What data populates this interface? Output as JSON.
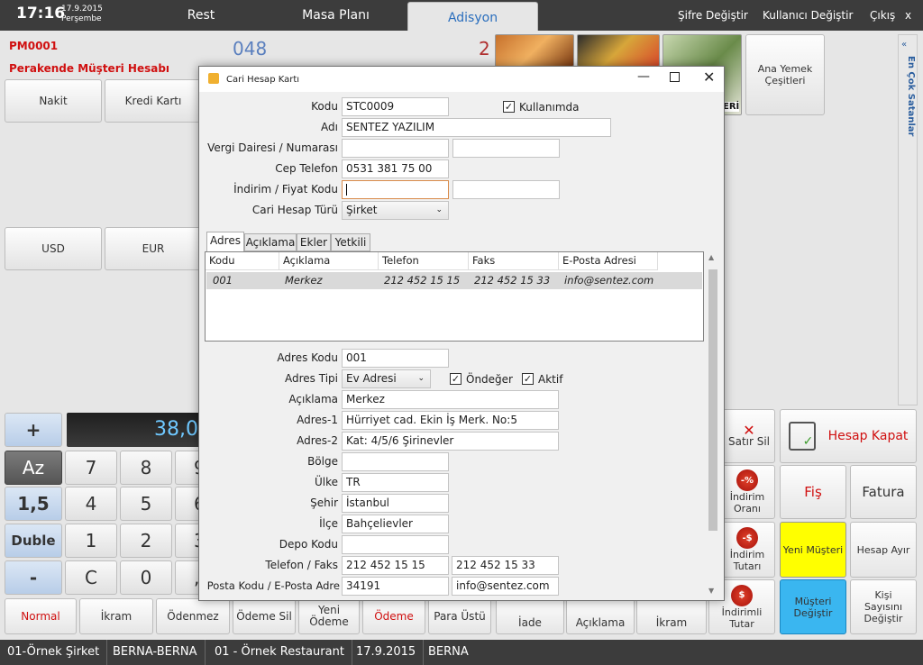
{
  "topbar": {
    "time": "17:16",
    "date": "17.9.2015",
    "weekday": "Perşembe",
    "tabs": [
      "Rest",
      "Masa Planı",
      "Adisyon"
    ],
    "links": [
      "Şifre Değiştir",
      "Kullanıcı Değiştir",
      "Çıkış",
      "x"
    ]
  },
  "account": {
    "code": "PM0001",
    "name": "Perakende Müşteri Hesabı",
    "table_no": "048",
    "guest_count": "2"
  },
  "payment_buttons": [
    "Nakit",
    "Kredi Kartı",
    "USD",
    "EUR"
  ],
  "category": {
    "label": "Ana Yemek Çeşitleri",
    "partial_tile_text": "ERİ"
  },
  "sidebar_right": {
    "label": "En Çok Satanlar"
  },
  "keypad": {
    "display": "38,0",
    "side": [
      "+",
      "Az",
      "1,5",
      "Duble",
      "-"
    ],
    "digits": [
      [
        "7",
        "8",
        "9"
      ],
      [
        "4",
        "5",
        "6"
      ],
      [
        "1",
        "2",
        "3"
      ],
      [
        "C",
        "0",
        ","
      ]
    ]
  },
  "bottom_buttons": [
    "Normal",
    "İkram",
    "Ödenmez",
    "Ödeme Sil",
    "Yeni Ödeme",
    "Ödeme",
    "Para Üstü",
    "İade",
    "Açıklama",
    "İkram",
    "İndirimli Tutar"
  ],
  "right_buttons": {
    "satir_sil": "Satır Sil",
    "hesap_kapat": "Hesap Kapat",
    "indirim_orani": "İndirim Oranı",
    "fis": "Fiş",
    "fatura": "Fatura",
    "indirim_tutari": "İndirim Tutarı",
    "yeni_musteri": "Yeni Müşteri",
    "hesap_ayir": "Hesap Ayır",
    "musteri_degistir": "Müşteri Değiştir",
    "kisi_sayisi": "Kişi Sayısını Değiştir",
    "pct_badge": "-%",
    "money_badge": "-$",
    "money_badge2": "$"
  },
  "statusbar": [
    "01-Örnek Şirket",
    "BERNA-BERNA",
    "01 - Örnek Restaurant",
    "17.9.2015",
    "BERNA"
  ],
  "dialog": {
    "title": "Cari Hesap Kartı",
    "labels": {
      "kodu": "Kodu",
      "adi": "Adı",
      "vergi": "Vergi Dairesi / Numarası",
      "cep": "Cep Telefon",
      "indirim": "İndirim / Fiyat Kodu",
      "tur": "Cari Hesap Türü",
      "kullanimda": "Kullanımda"
    },
    "values": {
      "kodu": "STC0009",
      "adi": "SENTEZ YAZILIM",
      "vergi_dairesi": "",
      "vergi_no": "",
      "cep": "0531 381 75 00",
      "indirim": "",
      "fiyat_kodu": "",
      "tur": "Şirket"
    },
    "tabs": [
      "Adres",
      "Açıklama",
      "Ekler",
      "Yetkili"
    ],
    "grid": {
      "headers": [
        "Kodu",
        "Açıklama",
        "Telefon",
        "Faks",
        "E-Posta Adresi"
      ],
      "rows": [
        [
          "001",
          "Merkez",
          "212 452 15 15",
          "212 452 15 33",
          "info@sentez.com"
        ]
      ]
    },
    "address": {
      "labels": {
        "adres_kodu": "Adres Kodu",
        "adres_tipi": "Adres Tipi",
        "ondeger": "Öndeğer",
        "aktif": "Aktif",
        "aciklama": "Açıklama",
        "adres1": "Adres-1",
        "adres2": "Adres-2",
        "bolge": "Bölge",
        "ulke": "Ülke",
        "sehir": "Şehir",
        "ilce": "İlçe",
        "depo": "Depo Kodu",
        "telefon": "Telefon / Faks",
        "posta": "Posta Kodu / E-Posta Adre"
      },
      "values": {
        "adres_kodu": "001",
        "adres_tipi": "Ev Adresi",
        "aciklama": "Merkez",
        "adres1": "Hürriyet cad. Ekin İş Merk. No:5",
        "adres2": "Kat: 4/5/6 Şirinevler",
        "bolge": "",
        "ulke": "TR",
        "sehir": "İstanbul",
        "ilce": "Bahçelievler",
        "depo": "",
        "telefon": "212 452 15 15",
        "faks": "212 452 15 33",
        "posta_kodu": "34191",
        "eposta": "info@sentez.com"
      }
    }
  },
  "colors": {
    "topbar": "#3c3c3c",
    "accent_blue": "#2a6ebd",
    "red": "#d01010",
    "yellow": "#ffff00",
    "cyan": "#3ab6f0"
  }
}
